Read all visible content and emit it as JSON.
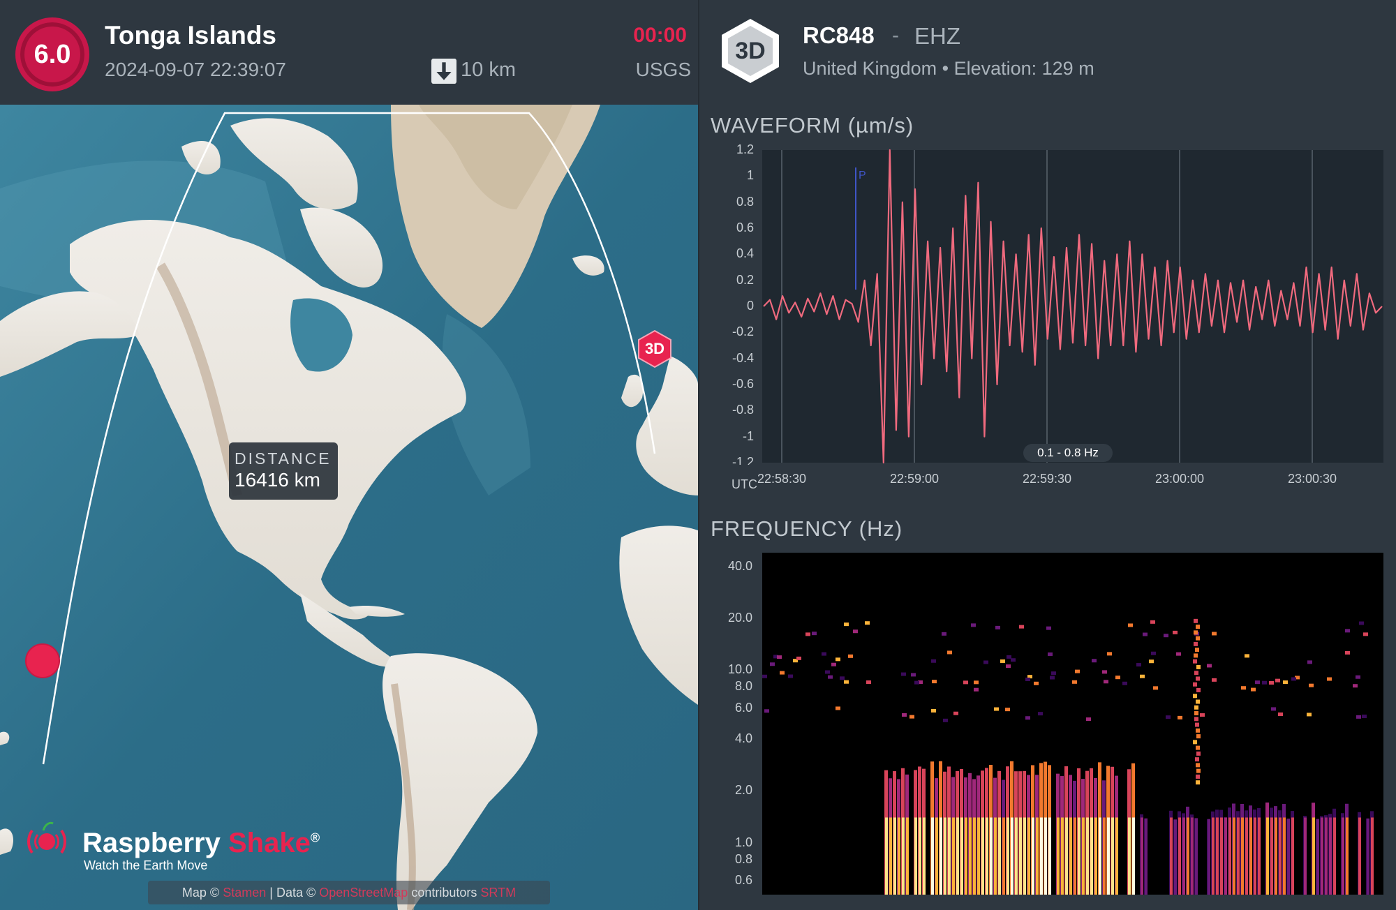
{
  "event": {
    "magnitude": "6.0",
    "region": "Tonga Islands",
    "datetime": "2024-09-07 22:39:07",
    "timer": "00:00",
    "depth": "10 km",
    "source": "USGS"
  },
  "map": {
    "distance_label": "DISTANCE",
    "distance_value": "16416 km",
    "station_marker": "3D",
    "brand_name_1": "Raspberry",
    "brand_name_2": "Shake",
    "brand_mark": "®",
    "brand_tagline": "Watch the Earth Move",
    "attribution_prefix": "Map ©",
    "attribution_link1": "Stamen",
    "attribution_mid": "| Data ©",
    "attribution_link2": "OpenStreetMap",
    "attribution_suffix": "contributors",
    "attribution_link3": "SRTM"
  },
  "station": {
    "badge": "3D",
    "id": "RC848",
    "separator": "-",
    "channel": "EHZ",
    "subtitle": "United Kingdom • Elevation: 129 m"
  },
  "waveform": {
    "title": "WAVEFORM (µm/s)",
    "band": "0.1 - 0.8 Hz",
    "utc_label": "UTC",
    "p_label": "P"
  },
  "frequency": {
    "title": "FREQUENCY (Hz)"
  },
  "colors": {
    "accent": "#e8234f",
    "waveform": "#f06a7e",
    "p_marker": "#3f55c8",
    "panel_bg": "#2e3740",
    "plot_bg": "#1f2830"
  },
  "chart_data": [
    {
      "type": "line",
      "title": "WAVEFORM (µm/s)",
      "xlabel": "UTC",
      "ylabel": "µm/s",
      "ylim": [
        -1.2,
        1.2
      ],
      "y_ticks": [
        "1.2",
        "1",
        "0.8",
        "0.6",
        "0.4",
        "0.2",
        "0",
        "-0.2",
        "-0.4",
        "-0.6",
        "-0.8",
        "-1",
        "-1.2"
      ],
      "x_ticks": [
        "22:58:30",
        "22:59:00",
        "22:59:30",
        "23:00:00",
        "23:00:30"
      ],
      "grid": "vertical",
      "annotations": [
        "P",
        "0.1 - 0.8 Hz"
      ],
      "series": [
        {
          "x_seconds_from_225830": [
            -4,
            -2,
            0,
            2,
            4,
            6,
            8,
            10,
            12,
            14,
            16,
            18,
            20,
            22,
            24,
            26,
            28,
            29,
            30,
            31,
            32,
            33,
            34,
            35,
            36,
            37,
            38,
            39,
            40,
            41,
            42,
            43,
            44,
            45,
            46,
            47,
            48,
            49,
            50,
            51,
            52,
            53,
            54,
            55,
            56,
            57,
            58,
            59,
            60,
            61,
            62,
            63,
            64,
            65,
            66,
            67,
            68,
            69,
            70,
            71,
            72,
            73,
            74,
            75,
            76,
            77,
            78,
            79,
            80,
            82,
            84,
            86,
            88,
            90,
            92,
            94,
            96,
            98,
            100,
            102,
            104,
            106,
            108,
            110,
            112,
            114,
            116,
            118,
            120,
            122,
            124,
            126,
            128,
            130,
            132,
            134,
            136,
            138,
            136
          ],
          "values": [
            0,
            0.05,
            -0.1,
            0.08,
            -0.05,
            0.03,
            -0.08,
            0.06,
            -0.04,
            0.1,
            -0.06,
            0.08,
            -0.1,
            0.05,
            0.02,
            -0.12,
            0.2,
            -0.3,
            0.25,
            -1.2,
            1.2,
            -0.95,
            0.8,
            -1.0,
            0.9,
            -0.6,
            0.5,
            -0.4,
            0.45,
            -0.5,
            0.6,
            -0.7,
            0.85,
            -0.4,
            0.95,
            -1.0,
            0.65,
            -0.6,
            0.5,
            -0.3,
            0.4,
            -0.35,
            0.55,
            -0.45,
            0.6,
            -0.25,
            0.38,
            -0.33,
            0.45,
            -0.28,
            0.55,
            -0.3,
            0.48,
            -0.4,
            0.35,
            -0.3,
            0.4,
            -0.3,
            0.5,
            -0.35,
            0.4,
            -0.25,
            0.3,
            -0.3,
            0.35,
            -0.2,
            0.3,
            -0.25,
            0.2,
            -0.2,
            0.25,
            -0.15,
            0.2,
            -0.2,
            0.18,
            -0.12,
            0.2,
            -0.18,
            0.15,
            -0.1,
            0.2,
            -0.15,
            0.12,
            -0.1,
            0.18,
            -0.15,
            0.3,
            -0.2,
            0.25,
            -0.18,
            0.3,
            -0.25,
            0.2,
            -0.15,
            0.25,
            -0.18,
            0.1,
            -0.05,
            0
          ]
        }
      ]
    },
    {
      "type": "heatmap",
      "title": "FREQUENCY (Hz)",
      "y_ticks": [
        "40.0",
        "20.0",
        "10.0",
        "8.0",
        "6.0",
        "4.0",
        "2.0",
        "1.0",
        "0.8",
        "0.6"
      ],
      "xlabel": "",
      "ylabel": "Hz",
      "scale": "log"
    }
  ]
}
